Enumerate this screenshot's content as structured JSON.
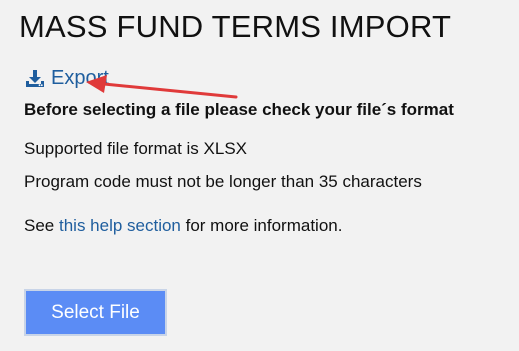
{
  "page": {
    "title": "MASS FUND TERMS IMPORT"
  },
  "export": {
    "label": "Export",
    "icon": "download-icon",
    "color": "#1f5e9e"
  },
  "instructions": {
    "heading": "Before selecting a file please check your file´s format",
    "lines": [
      "Supported file format is XLSX",
      "Program code must not be longer than 35 characters"
    ]
  },
  "help": {
    "prefix": "See ",
    "link_text": "this help section",
    "suffix": " for more information."
  },
  "select_file": {
    "label": "Select File",
    "color": "#5b8cf5"
  },
  "annotation": {
    "color": "#e03a3a",
    "icon": "red-arrow-annotation"
  }
}
